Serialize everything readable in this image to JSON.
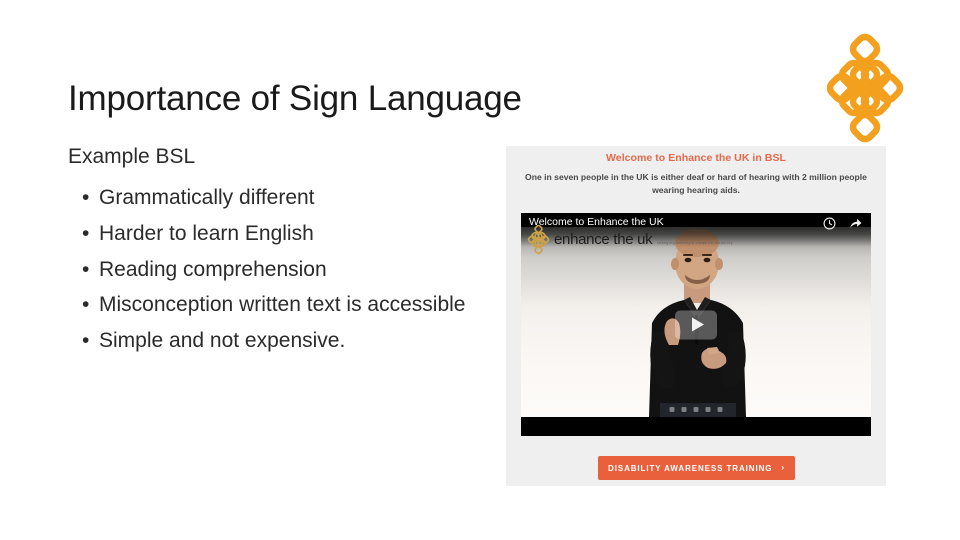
{
  "slide": {
    "title": "Importance of Sign Language",
    "lead": "Example BSL",
    "bullet_char": "•",
    "bullets": [
      "Grammatically different",
      "Harder to learn English",
      "Reading comprehension",
      "Misconception written text is accessible",
      "Simple and not expensive."
    ]
  },
  "corner_logo": {
    "name": "enhance-the-uk-knot-logo",
    "color": "#F2A01E"
  },
  "embed": {
    "heading": "Welcome to Enhance the UK in BSL",
    "heading_color": "#E4694A",
    "subtext": "One in seven people in the UK is either deaf or hard of hearing with 2 million people wearing hearing aids.",
    "video": {
      "title": "Welcome to Enhance the UK",
      "brand_name": "enhance the uk",
      "brand_tagline": "changing society's views on disability",
      "watch_later_icon": "clock-icon",
      "share_icon": "share-arrow-icon",
      "play_icon": "play-triangle-icon"
    },
    "cta": {
      "label": "DISABILITY AWARENESS TRAINING",
      "arrow": "›",
      "color": "#E8603C"
    }
  }
}
